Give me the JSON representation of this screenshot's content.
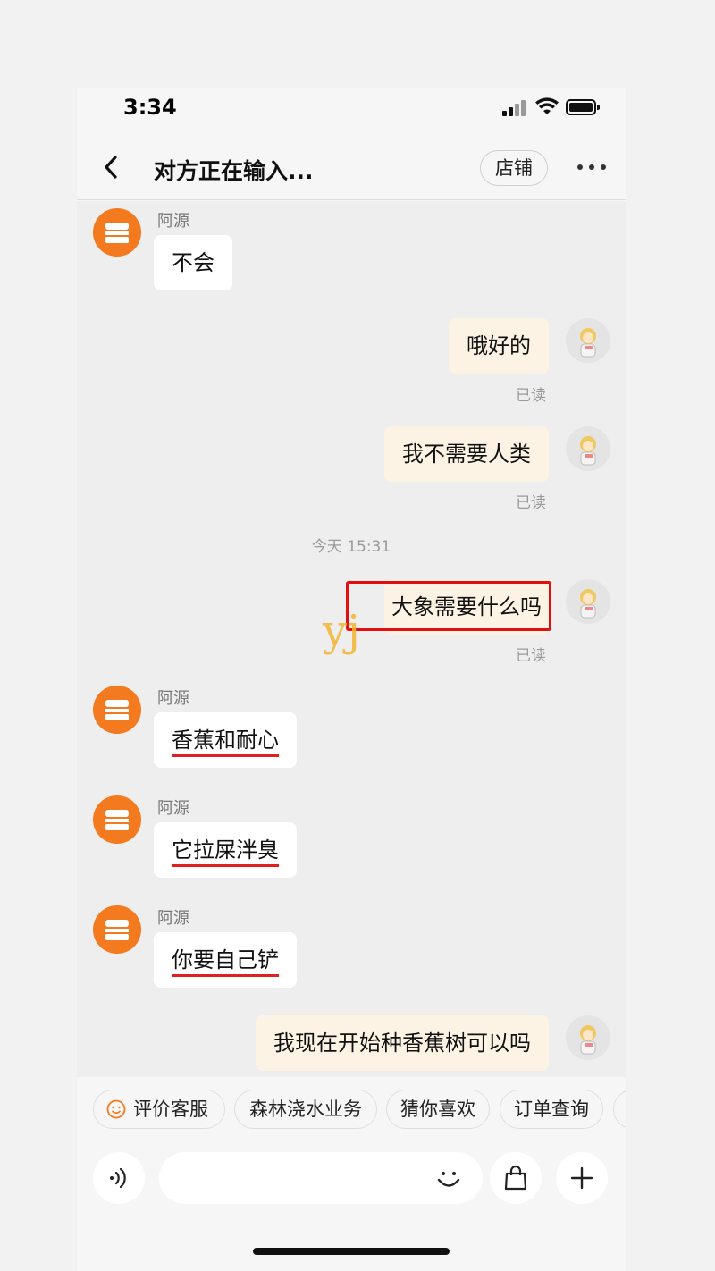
{
  "status_bar": {
    "time": "3:34"
  },
  "header": {
    "title": "对方正在输入...",
    "shop_label": "店铺"
  },
  "colors": {
    "brand_orange": "#f47a1f",
    "user_bubble": "#fdf3e4",
    "highlight_red": "#e01010"
  },
  "messages": [
    {
      "side": "left",
      "sender": "阿源",
      "text": "不会"
    },
    {
      "side": "right",
      "text": "哦好的",
      "status": "已读"
    },
    {
      "side": "right",
      "text": "我不需要人类",
      "status": "已读"
    },
    {
      "side": "right",
      "text": "大象需要什么吗",
      "status": "已读"
    },
    {
      "side": "left",
      "sender": "阿源",
      "text": "香蕉和耐心"
    },
    {
      "side": "left",
      "sender": "阿源",
      "text": "它拉屎泮臭"
    },
    {
      "side": "left",
      "sender": "阿源",
      "text": "你要自己铲"
    },
    {
      "side": "right",
      "text": "我现在开始种香蕉树可以吗"
    }
  ],
  "timestamp": "今天 15:31",
  "watermark": "yj",
  "quick_replies": [
    "评价客服",
    "森林浇水业务",
    "猜你喜欢",
    "订单查询"
  ],
  "input": {
    "placeholder": ""
  },
  "icons": [
    "back-icon",
    "more-icon",
    "smile-icon",
    "voice-icon",
    "emoji-icon",
    "bag-icon",
    "plus-icon"
  ]
}
